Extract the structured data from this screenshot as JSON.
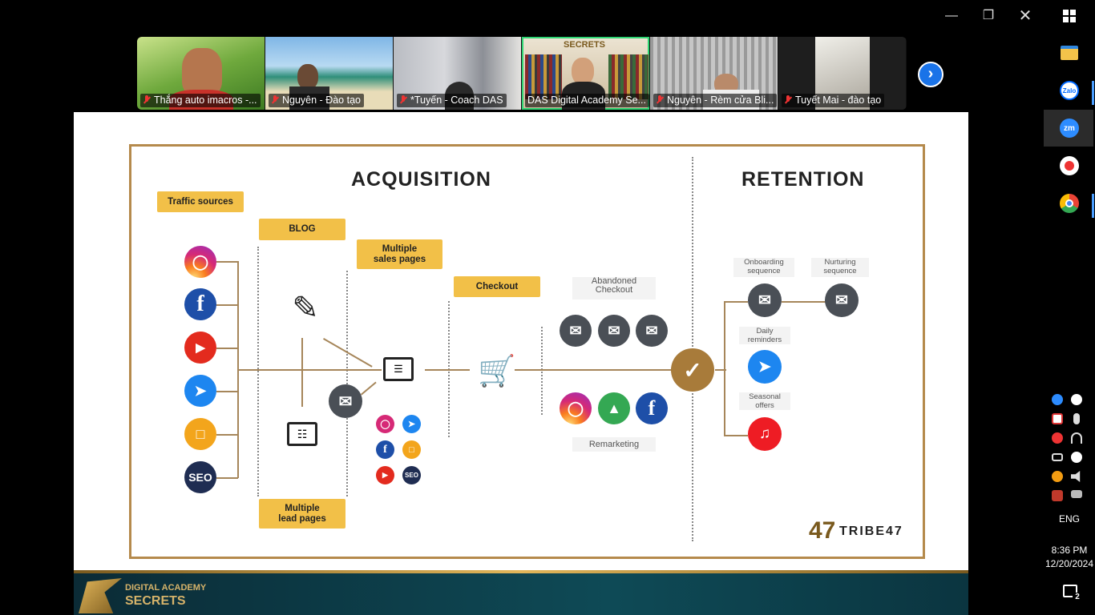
{
  "participants": [
    {
      "name": "Thắng auto imacros -...",
      "muted": true
    },
    {
      "name": "Nguyên - Đào tạo",
      "muted": true
    },
    {
      "name": "*Tuyến - Coach DAS",
      "muted": true
    },
    {
      "name": "DAS Digital Academy Se...",
      "muted": false,
      "speaking": true
    },
    {
      "name": "Nguyên - Rèm cửa Bli...",
      "muted": true
    },
    {
      "name": "Tuyết Mai - đào tạo",
      "muted": true
    }
  ],
  "speaker_banner": "SECRETS",
  "slide": {
    "acquisition_title": "ACQUISITION",
    "retention_title": "RETENTION",
    "tags": {
      "traffic": "Traffic sources",
      "blog": "BLOG",
      "sales": "Multiple\nsales pages",
      "checkout": "Checkout",
      "lead": "Multiple\nlead pages"
    },
    "labels": {
      "abandoned": "Abandoned\nCheckout",
      "remarketing": "Remarketing",
      "onboarding": "Onboarding\nsequence",
      "nurturing": "Nurturing\nsequence",
      "daily": "Daily\nreminders",
      "seasonal": "Seasonal\noffers"
    },
    "seo_label": "SEO",
    "brand": "TRIBE47",
    "footer_logo_line1": "DIGITAL ACADEMY",
    "footer_logo_line2": "SECRETS"
  },
  "taskbar": {
    "language": "ENG",
    "time": "8:36 PM",
    "date": "12/20/2024",
    "notifications": "2",
    "zalo": "Zalo",
    "zoom": "zm"
  },
  "colors": {
    "accent_gold": "#b58a4c",
    "tag_yellow": "#f2c048",
    "active_green": "#2ed573"
  }
}
